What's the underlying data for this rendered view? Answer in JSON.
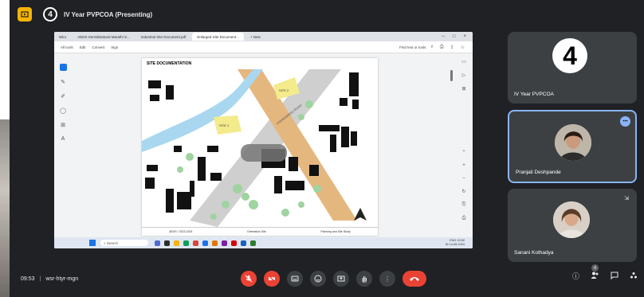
{
  "topbar": {
    "badge": "4",
    "title": "IV Year PVPCOA (Presenting)"
  },
  "browser": {
    "tabs": [
      "Wiro",
      "AEDS Semidetatural Marathi S...",
      "Industrial Site Document.pdf",
      "Enlarged Site Document...",
      "+ New"
    ],
    "toolbar": {
      "all_tools": "All tools",
      "edit": "Edit",
      "convert": "Convert",
      "sign": "Sign",
      "find": "Find text or tools"
    }
  },
  "document": {
    "title": "SITE DOCUMENTATION",
    "road_label": "VISHRAMBAG ROAD",
    "site_labels": [
      "SITE 1",
      "SITE 2"
    ],
    "footer": [
      "AEDS / 2023-2024",
      "Orientation Site",
      "Planning and Site Study"
    ]
  },
  "taskbar": {
    "search": "Search",
    "tray_line1": "ENG",
    "tray_line2": "IN",
    "clock": "10:52",
    "date": "14-08-2024"
  },
  "participants": [
    {
      "name": "IV Year PVPCOA",
      "initial": "4"
    },
    {
      "name": "Pranjali Deshpande",
      "speaking": true
    },
    {
      "name": "Sanani Kothadya"
    }
  ],
  "bottombar": {
    "time": "09:53",
    "separator": "|",
    "meeting_code": "wsr-htyr-mgn",
    "people_count": "4"
  },
  "colors": {
    "accent": "#8ab4f8",
    "end_call": "#ea4335",
    "present_chip": "#f6b400",
    "background": "#202124"
  }
}
